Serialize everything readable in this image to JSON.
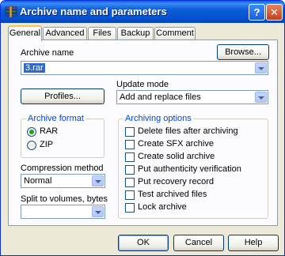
{
  "window": {
    "title": "Archive name and parameters",
    "help_button": "?",
    "close_button": "✕",
    "colors": {
      "titlebar": "#0b5fd6",
      "dialog_bg": "#ece9d8",
      "group_title": "#0046d5",
      "selection": "#316ac5"
    }
  },
  "tabs": [
    {
      "label": "General",
      "active": true
    },
    {
      "label": "Advanced",
      "active": false
    },
    {
      "label": "Files",
      "active": false
    },
    {
      "label": "Backup",
      "active": false
    },
    {
      "label": "Comment",
      "active": false
    }
  ],
  "general": {
    "archive_name_label": "Archive name",
    "archive_name_value": "3.rar",
    "browse_button": "Browse...",
    "profiles_button": "Profiles...",
    "update_mode_label": "Update mode",
    "update_mode_value": "Add and replace files",
    "archive_format": {
      "title": "Archive format",
      "options": [
        {
          "label": "RAR",
          "selected": true
        },
        {
          "label": "ZIP",
          "selected": false
        }
      ]
    },
    "compression_label": "Compression method",
    "compression_value": "Normal",
    "split_label": "Split to volumes, bytes",
    "split_value": "",
    "archiving_options": {
      "title": "Archiving options",
      "options": [
        {
          "label": "Delete files after archiving",
          "checked": false
        },
        {
          "label": "Create SFX archive",
          "checked": false
        },
        {
          "label": "Create solid archive",
          "checked": false
        },
        {
          "label": "Put authenticity verification",
          "checked": false
        },
        {
          "label": "Put recovery record",
          "checked": false
        },
        {
          "label": "Test archived files",
          "checked": false
        },
        {
          "label": "Lock archive",
          "checked": false
        }
      ]
    }
  },
  "footer": {
    "ok_button": "OK",
    "cancel_button": "Cancel",
    "help_button": "Help"
  }
}
